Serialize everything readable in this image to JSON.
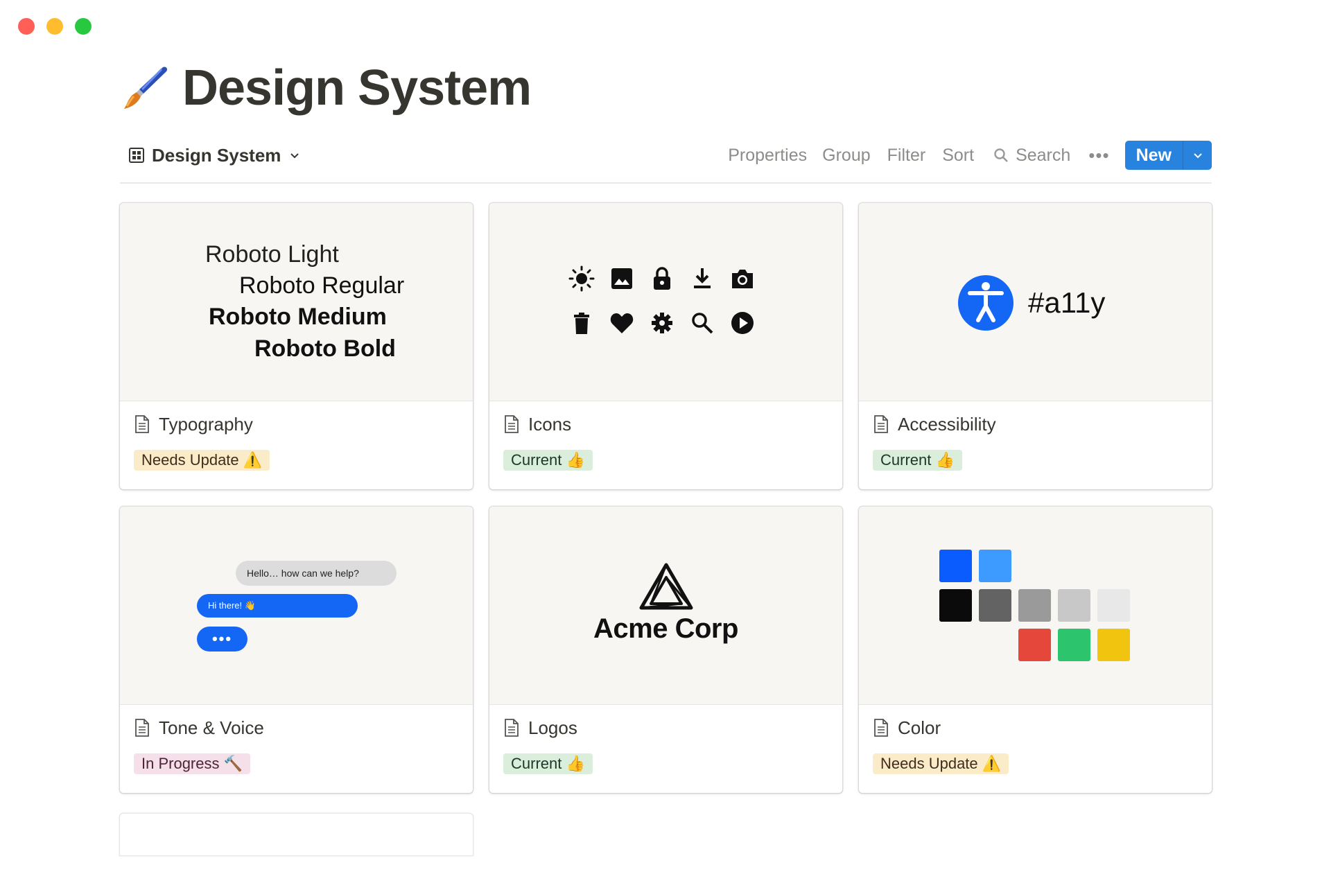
{
  "window": {
    "controls": [
      "close",
      "minimize",
      "zoom"
    ]
  },
  "page": {
    "icon": "paintbrush-icon",
    "title": "Design System"
  },
  "toolbar": {
    "view_icon": "table-icon",
    "view_label": "Design System",
    "properties": "Properties",
    "group": "Group",
    "filter": "Filter",
    "sort": "Sort",
    "search": "Search",
    "more": "•••",
    "new_label": "New"
  },
  "colors": {
    "accent": "#2783de",
    "tag_update_bg": "#fbecc9",
    "tag_current_bg": "#dbeddb",
    "tag_progress_bg": "#f5e0e9"
  },
  "cards": [
    {
      "title": "Typography",
      "tag": "Needs Update ⚠️",
      "cover": {
        "lines": [
          "Roboto Light",
          "Roboto Regular",
          "Roboto Medium",
          "Roboto Bold"
        ]
      }
    },
    {
      "title": "Icons",
      "tag": "Current 👍",
      "cover": {
        "icons": [
          "sun-icon",
          "image-icon",
          "lock-icon",
          "download-icon",
          "camera-icon",
          "trash-icon",
          "heart-icon",
          "gear-icon",
          "search-icon",
          "play-icon"
        ]
      }
    },
    {
      "title": "Accessibility",
      "tag": "Current 👍",
      "cover": {
        "icon": "accessibility-icon",
        "text": "#a11y"
      }
    },
    {
      "title": "Tone & Voice",
      "tag": "In Progress 🔨",
      "cover": {
        "incoming": "Hello… how can we help?",
        "outgoing": "Hi there! 👋",
        "typing": "•••"
      }
    },
    {
      "title": "Logos",
      "tag": "Current 👍",
      "cover": {
        "icon": "acme-logo-icon",
        "text": "Acme Corp"
      }
    },
    {
      "title": "Color",
      "tag": "Needs Update ⚠️",
      "cover": {
        "swatches": [
          "#0a5cff",
          "#3d9bff",
          "#0b0b0b",
          "#636363",
          "#9a9a9a",
          "#c8c8c8",
          "#e8e8e8",
          "#e5483b",
          "#2cc46c",
          "#f1c40f"
        ]
      }
    }
  ]
}
